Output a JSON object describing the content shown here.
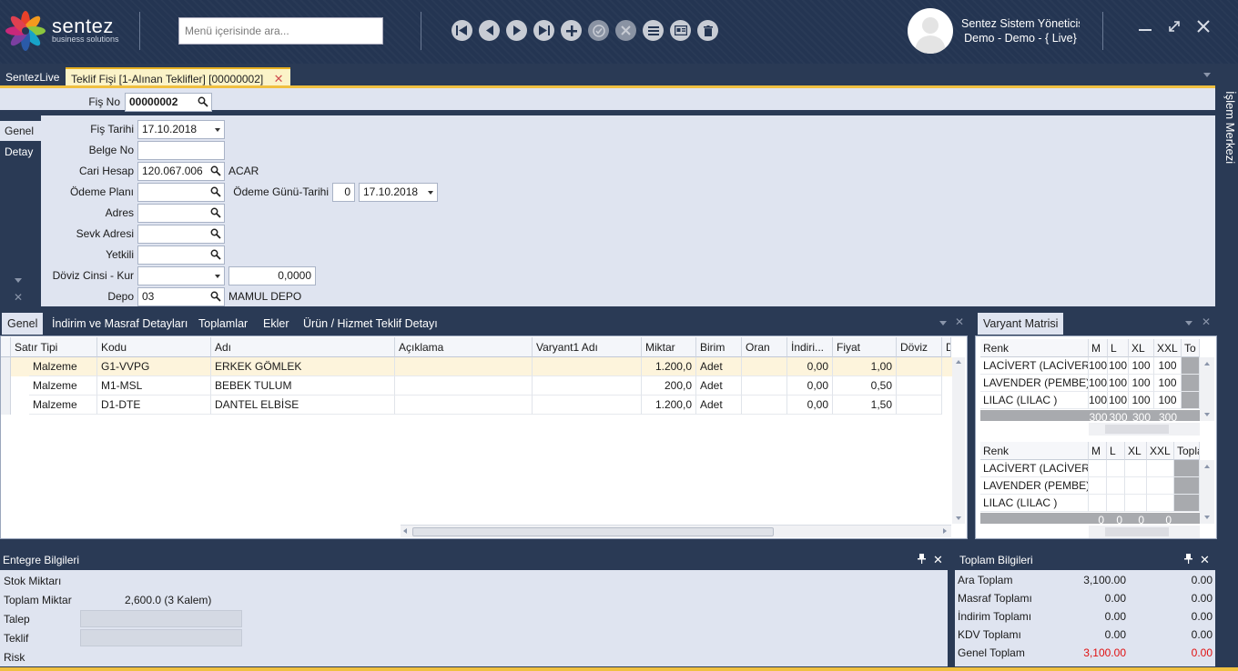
{
  "header": {
    "logo_name": "sentez",
    "logo_sub": "business solutions",
    "search_placeholder": "Menü içerisinde ara...",
    "toolbar_icons": [
      "first-icon",
      "prev-icon",
      "next-icon",
      "last-icon",
      "add-icon",
      "confirm-icon",
      "cancel-icon",
      "list-icon",
      "card-icon",
      "delete-icon"
    ],
    "user_name": "Sentez Sistem Yöneticisi",
    "user_company": "Demo - Demo - { Live}"
  },
  "tabs": {
    "live": "SentezLive",
    "active": "Teklif Fişi  [1-Alınan Teklifler] [00000002]"
  },
  "side_panel": "İşlem Merkezi",
  "form": {
    "fis_no_label": "Fiş No",
    "fis_no": "00000002",
    "left_tabs": [
      "Genel",
      "Detay"
    ],
    "fis_tarihi_label": "Fiş Tarihi",
    "fis_tarihi": "17.10.2018",
    "belge_no_label": "Belge No",
    "belge_no": "",
    "cari_hesap_label": "Cari Hesap",
    "cari_hesap": "120.067.006",
    "cari_hesap_name": "ACAR",
    "odeme_plani_label": "Ödeme Planı",
    "odeme_plani": "",
    "odeme_gunu_label": "Ödeme Günü-Tarihi",
    "odeme_gunu": "0",
    "odeme_tarihi": "17.10.2018",
    "adres_label": "Adres",
    "sevk_adresi_label": "Sevk Adresi",
    "yetkili_label": "Yetkili",
    "doviz_label": "Döviz Cinsi - Kur",
    "doviz_kur": "0,0000",
    "depo_label": "Depo",
    "depo": "03",
    "depo_name": "MAMUL DEPO"
  },
  "grid_tabs": [
    "Genel",
    "İndirim ve Masraf Detayları",
    "Toplamlar",
    "Ekler",
    "Ürün / Hizmet Teklif Detayı"
  ],
  "grid": {
    "columns": [
      "Satır Tipi",
      "Kodu",
      "Adı",
      "Açıklama",
      "Varyant1 Adı",
      "Miktar",
      "Birim",
      "Oran",
      "İndiri...",
      "Fiyat",
      "Döviz",
      "D"
    ],
    "rows": [
      {
        "tip": "Malzeme",
        "kodu": "G1-VVPG",
        "adi": "ERKEK GÖMLEK",
        "aciklama": "",
        "varyant": "",
        "miktar": "1.200,0",
        "birim": "Adet",
        "oran": "",
        "indirim": "0,00",
        "fiyat": "1,00",
        "doviz": ""
      },
      {
        "tip": "Malzeme",
        "kodu": "M1-MSL",
        "adi": "BEBEK TULUM",
        "aciklama": "",
        "varyant": "",
        "miktar": "200,0",
        "birim": "Adet",
        "oran": "",
        "indirim": "0,00",
        "fiyat": "0,50",
        "doviz": ""
      },
      {
        "tip": "Malzeme",
        "kodu": "D1-DTE",
        "adi": "DANTEL ELBİSE",
        "aciklama": "",
        "varyant": "",
        "miktar": "1.200,0",
        "birim": "Adet",
        "oran": "",
        "indirim": "0,00",
        "fiyat": "1,50",
        "doviz": ""
      }
    ]
  },
  "variant": {
    "tab": "Varyant Matrisi",
    "top": {
      "columns": [
        "Renk",
        "M",
        "L",
        "XL",
        "XXL",
        "To"
      ],
      "rows": [
        [
          "LACİVERT (LACİVERT)",
          "100",
          "100",
          "100",
          "100"
        ],
        [
          "LAVENDER (PEMBE)",
          "100",
          "100",
          "100",
          "100"
        ],
        [
          "LILAC (LILAC )",
          "100",
          "100",
          "100",
          "100"
        ]
      ],
      "totals": [
        "300",
        "300",
        "300",
        "300"
      ]
    },
    "bottom": {
      "columns": [
        "Renk",
        "M",
        "L",
        "XL",
        "XXL",
        "Topla"
      ],
      "rows": [
        [
          "LACİVERT (LACİVERT)"
        ],
        [
          "LAVENDER (PEMBE)"
        ],
        [
          "LILAC (LILAC )"
        ]
      ],
      "totals": [
        "0",
        "0",
        "0",
        "0"
      ]
    }
  },
  "entegre": {
    "title": "Entegre Bilgileri",
    "stok_label": "Stok Miktarı",
    "toplam_label": "Toplam Miktar",
    "toplam_value": "2,600.0  (3 Kalem)",
    "talep_label": "Talep",
    "teklif_label": "Teklif",
    "risk_label": "Risk"
  },
  "toplam": {
    "title": "Toplam Bilgileri",
    "rows": [
      {
        "label": "Ara Toplam",
        "v1": "3,100.00",
        "v2": "0.00"
      },
      {
        "label": "Masraf Toplamı",
        "v1": "0.00",
        "v2": "0.00"
      },
      {
        "label": "İndirim Toplamı",
        "v1": "0.00",
        "v2": "0.00"
      },
      {
        "label": "KDV Toplamı",
        "v1": "0.00",
        "v2": "0.00"
      },
      {
        "label": "Genel Toplam",
        "v1": "3,100.00",
        "v2": "0.00"
      }
    ],
    "highlight_color": "#e01010"
  }
}
